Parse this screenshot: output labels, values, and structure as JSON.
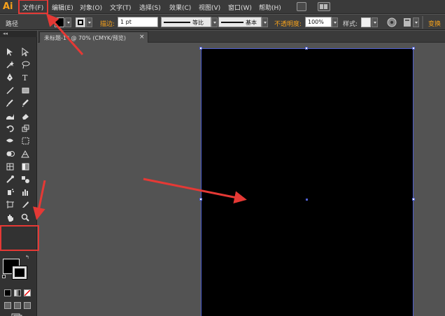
{
  "app": {
    "logo": "Ai",
    "logo_color": "#f7a21b"
  },
  "menu": [
    {
      "id": "file",
      "label": "文件(F)"
    },
    {
      "id": "edit",
      "label": "编辑(E)"
    },
    {
      "id": "object",
      "label": "对象(O)"
    },
    {
      "id": "text",
      "label": "文字(T)"
    },
    {
      "id": "select",
      "label": "选择(S)"
    },
    {
      "id": "effect",
      "label": "效果(C)"
    },
    {
      "id": "view",
      "label": "视图(V)"
    },
    {
      "id": "window",
      "label": "窗口(W)"
    },
    {
      "id": "help",
      "label": "帮助(H)"
    }
  ],
  "control": {
    "selection_label": "路径",
    "stroke_label": "描边:",
    "stroke_weight": "1 pt",
    "profile_label": "等比",
    "brush_label": "基本",
    "opacity_label": "不透明度:",
    "opacity_value": "100%",
    "style_label": "样式:",
    "transform_label": "变换"
  },
  "document": {
    "tab_label": "未标题-1* @ 70% (CMYK/预览)",
    "close_label": "×"
  },
  "tools": [
    "selection-tool",
    "direct-selection-tool",
    "magic-wand-tool",
    "lasso-tool",
    "pen-tool",
    "type-tool",
    "line-segment-tool",
    "rectangle-tool",
    "paintbrush-tool",
    "pencil-tool",
    "blob-brush-tool",
    "eraser-tool",
    "rotate-tool",
    "scale-tool",
    "width-tool",
    "free-transform-tool",
    "shape-builder-tool",
    "perspective-grid-tool",
    "mesh-tool",
    "gradient-tool",
    "eyedropper-tool",
    "blend-tool",
    "symbol-sprayer-tool",
    "column-graph-tool",
    "artboard-tool",
    "slice-tool",
    "hand-tool",
    "zoom-tool"
  ],
  "colors": {
    "fill": "#000000",
    "stroke": "#000000",
    "artboard": "#000000",
    "selection": "#4f5fd0",
    "annotation_red": "#e53935"
  }
}
